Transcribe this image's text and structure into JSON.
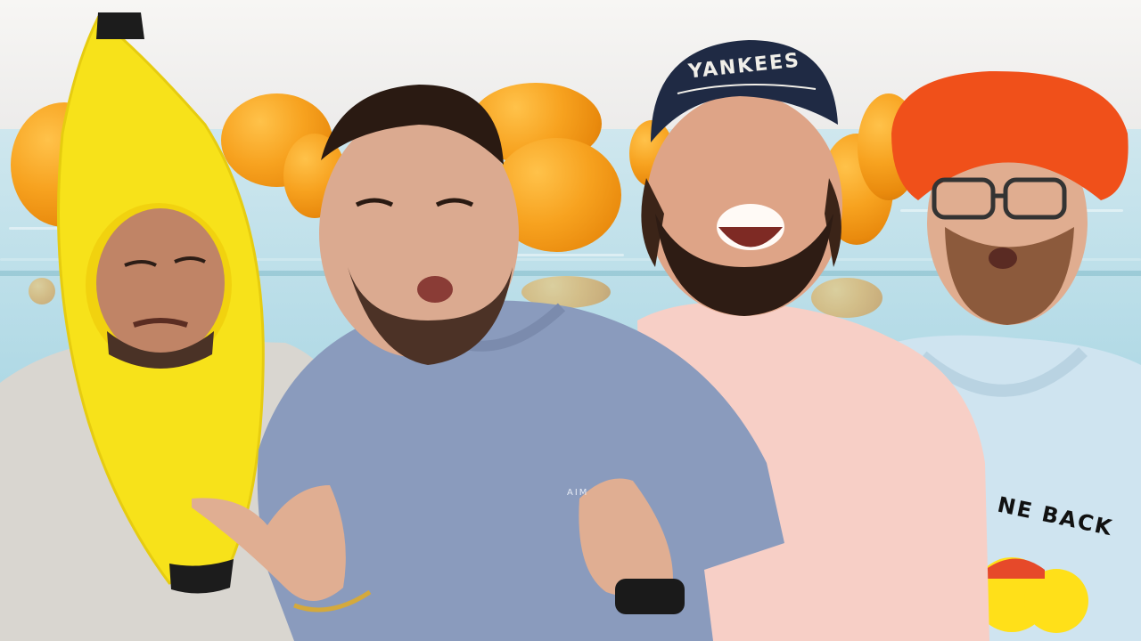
{
  "scene": {
    "description_free": true,
    "colors": {
      "wall": "#f3f1ee",
      "water": "#a9d6e3",
      "orange": "#f7a21f",
      "banana": "#f7e21a",
      "cap_navy": "#1f2a44",
      "beret": "#f0501a"
    }
  },
  "cap_text": "YANKEES",
  "shirt_small_text": "AIM",
  "shirt_back_text": "NE BACK"
}
